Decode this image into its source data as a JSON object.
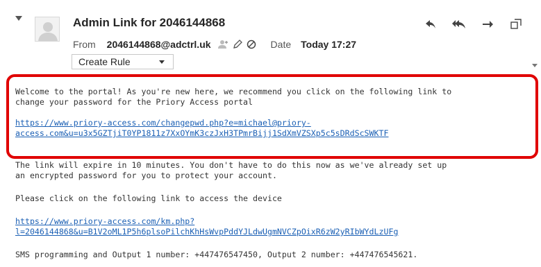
{
  "header": {
    "subject": "Admin Link for 2046144868",
    "from_label": "From",
    "from_address": "2046144868@adctrl.uk",
    "date_label": "Date",
    "date_value": "Today 17:27",
    "create_rule_label": "Create Rule"
  },
  "icons": {
    "collapse": "collapse-caret-icon",
    "avatar": "user-avatar-icon",
    "reply": "reply-icon",
    "reply_all": "reply-all-icon",
    "forward": "forward-icon",
    "popout": "popout-icon",
    "add_contact": "add-contact-icon",
    "edit": "edit-icon",
    "block": "block-icon"
  },
  "body": {
    "welcome_line1": "Welcome to the portal! As you're new here, we recommend you click on the following link to",
    "welcome_line2": "change your password for the Priory Access portal",
    "link1_line1": "https://www.priory-access.com/changepwd.php?e=michael@priory-",
    "link1_line2": "access.com&u=u3x5GZTjiT0YP1811z7XxOYmK3czJxH3TPmrBijj1SdXmVZSXp5c5sDRdScSWKTF",
    "expire_line1": "The link will expire in 10 minutes. You don't have to do this now as we've already set up",
    "expire_line2": "an encrypted password for you to protect your account.",
    "device_line": "Please click on the following link to access the device",
    "link2_line1": "https://www.priory-access.com/km.php?",
    "link2_line2": "l=2046144868&u=B1V2oML1P5h6plsoPilchKhHsWvpPddYJLdwUgmNVCZpOixR6zW2yRIbWYdLzUFg",
    "sms_line": "SMS programming and Output 1 number: +447476547450, Output 2 number: +447476545621."
  },
  "colors": {
    "highlight": "#e00000",
    "link": "#1a5fb4"
  }
}
